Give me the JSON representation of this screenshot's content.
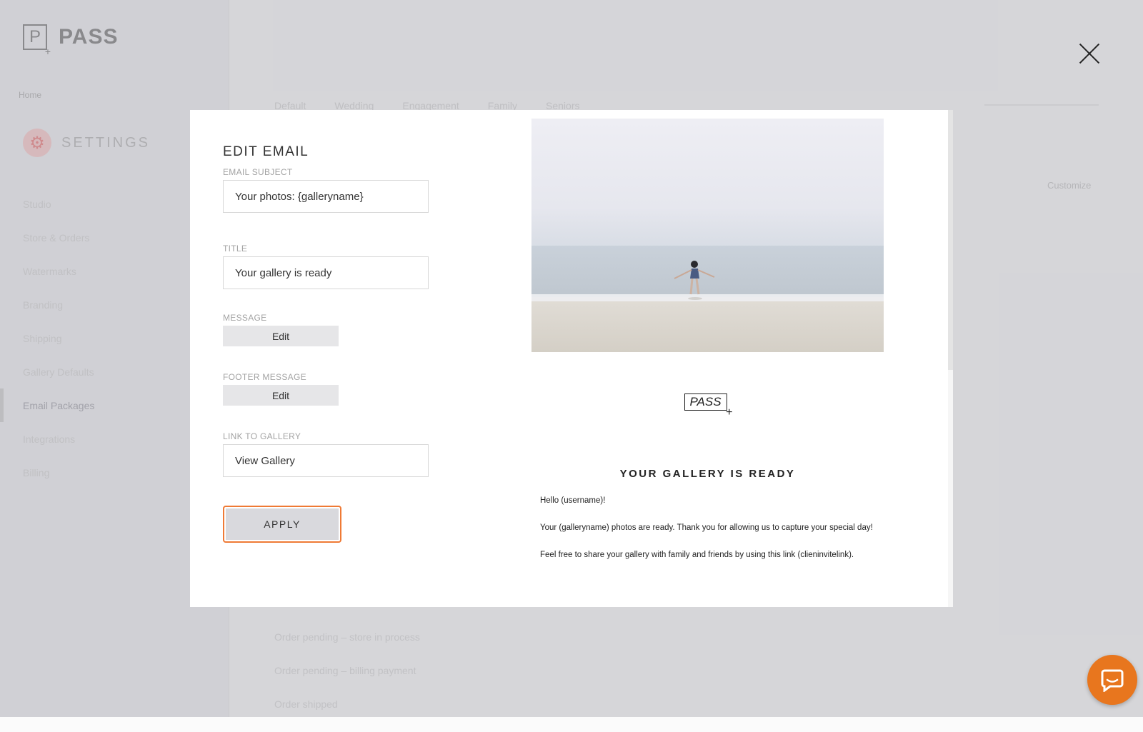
{
  "app": {
    "logo_text": "PASS",
    "logo_letter": "P",
    "home_link": "Home",
    "settings_label": "SETTINGS",
    "sidebar_items": [
      {
        "label": "Studio",
        "active": false
      },
      {
        "label": "Store & Orders",
        "active": false
      },
      {
        "label": "Watermarks",
        "active": false
      },
      {
        "label": "Branding",
        "active": false
      },
      {
        "label": "Shipping",
        "active": false
      },
      {
        "label": "Gallery Defaults",
        "active": false
      },
      {
        "label": "Email Packages",
        "active": true
      },
      {
        "label": "Integrations",
        "active": false
      },
      {
        "label": "Billing",
        "active": false
      }
    ],
    "tabs": [
      "Default",
      "Wedding",
      "Engagement",
      "Family",
      "Seniors"
    ],
    "customize_label": "Customize",
    "background_rows": [
      "Order pending – store in process",
      "Order pending – billing payment",
      "Order shipped"
    ]
  },
  "modal": {
    "title": "EDIT EMAIL",
    "email_subject": {
      "label": "EMAIL SUBJECT",
      "value": "Your photos: {galleryname}"
    },
    "title_field": {
      "label": "TITLE",
      "value": "Your gallery is ready"
    },
    "message": {
      "label": "MESSAGE",
      "button": "Edit"
    },
    "footer_message": {
      "label": "FOOTER MESSAGE",
      "button": "Edit"
    },
    "link_to_gallery": {
      "label": "LINK TO GALLERY",
      "value": "View Gallery"
    },
    "apply_label": "APPLY"
  },
  "preview": {
    "brand_logo": "PASS",
    "heading": "YOUR GALLERY IS READY",
    "paragraphs": [
      "Hello (username)!",
      "Your (galleryname) photos are ready. Thank you for allowing us to capture your special day!",
      "Feel free to share your gallery with family and friends by using this link (clieninvitelink)."
    ]
  },
  "colors": {
    "accent_orange": "#e8761e",
    "apply_focus_border": "#ef7a35",
    "settings_icon_bg": "#fbd6d6"
  }
}
